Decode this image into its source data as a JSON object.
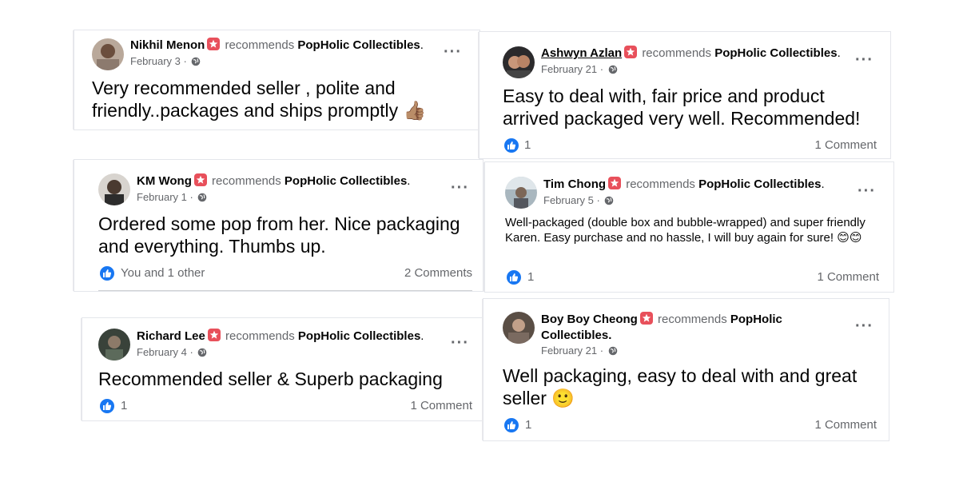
{
  "page_name": "PopHolic Collectibles",
  "recommends": "recommends",
  "colors": {
    "link": "#1877f2",
    "muted": "#65676b",
    "badge": "#e8505b"
  },
  "reviews": [
    {
      "name": "Nikhil Menon",
      "date": "February 3 ·",
      "text": "Very recommended seller , polite and friendly..packages and ships promptly 👍🏽",
      "likes": "",
      "comments": ""
    },
    {
      "name": "Ashwyn Azlan",
      "date": "February 21 ·",
      "text": "Easy to deal with, fair price and product arrived packaged very well. Recommended!",
      "likes": "1",
      "comments": "1 Comment"
    },
    {
      "name": "KM Wong",
      "date": "February 1 ·",
      "text": "Ordered some pop from her. Nice packaging and everything. Thumbs up.",
      "likes": "You and 1 other",
      "comments": "2 Comments"
    },
    {
      "name": "Tim Chong",
      "date": "February 5 ·",
      "text": "Well-packaged (double box and bubble-wrapped) and super friendly Karen. Easy purchase and no hassle, I will buy again for sure! 😊😊",
      "likes": "1",
      "comments": "1 Comment"
    },
    {
      "name": "Richard Lee",
      "date": "February 4 ·",
      "text": "Recommended seller & Superb packaging",
      "likes": "1",
      "comments": "1 Comment"
    },
    {
      "name": "Boy Boy Cheong",
      "date": "February 21 ·",
      "text": "Well packaging, easy to deal with and great seller 🙂",
      "likes": "1",
      "comments": "1 Comment",
      "page_line1": "PopHolic",
      "page_line2": "Collectibles."
    }
  ]
}
